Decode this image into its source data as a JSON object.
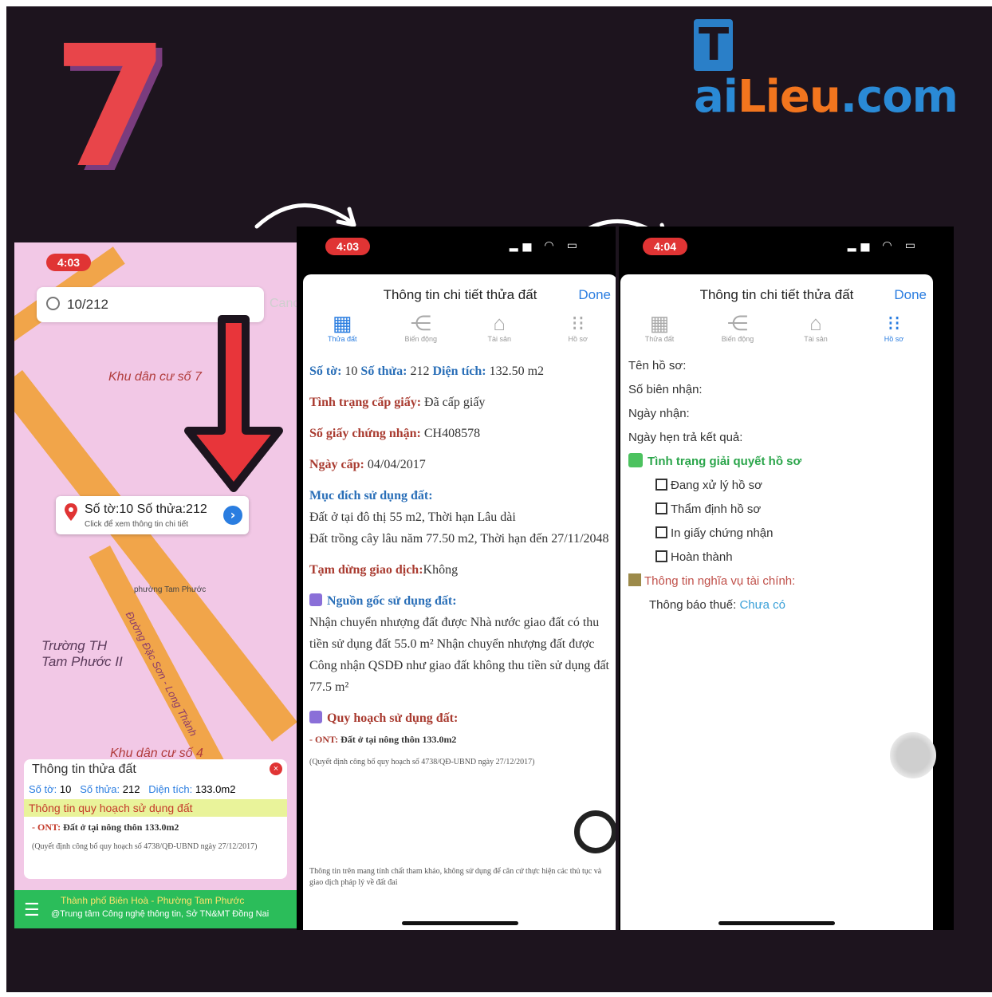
{
  "step_number": "7",
  "logo": {
    "t": "T",
    "ai": "ai",
    "lieu": "Lieu",
    "com": ".com"
  },
  "colors": {
    "accent_red": "#e03434",
    "link_blue": "#2a7de0",
    "green": "#2bbd5a"
  },
  "phone1": {
    "time": "4:03",
    "search_value": "10/212",
    "cancel_label": "Canc",
    "map_labels": [
      "Khu dân cư số 7",
      "Trường TH\nTam Phước II",
      "phường Tam Phước",
      "Khu dân cư số 4",
      "Đường Đặc Sơn - Long Thành"
    ],
    "popup": {
      "title": "Số tờ:10 Số thửa:212",
      "hint": "Click để xem thông tin chi tiết"
    },
    "sheet": {
      "title": "Thông tin thửa đất",
      "so_to_label": "Số tờ:",
      "so_to": "10",
      "so_thua_label": "Số thửa:",
      "so_thua": "212",
      "dien_tich_label": "Diện tích:",
      "dien_tich": "133.0m2",
      "quy_hoach_label": "Thông tin quy hoạch sử dụng đất",
      "ont_code": "- ONT:",
      "ont_text": "Đất ở tại nông thôn 133.0m2",
      "quyet_dinh": "(Quyết định công bố quy hoạch số 4738/QĐ-UBND ngày 27/12/2017)"
    },
    "footer": {
      "line1": "Thành phố Biên Hoà - Phường Tam Phước",
      "line2": "@Trung tâm Công nghệ thông tin, Sở TN&MT Đồng Nai"
    }
  },
  "phone2": {
    "time": "4:03",
    "title": "Thông tin chi tiết thửa đất",
    "done": "Done",
    "tabs": [
      "Thửa đất",
      "Biến động",
      "Tài sản",
      "Hồ sơ"
    ],
    "so_to_label": "Số tờ:",
    "so_to": "10",
    "so_thua_label": "Số thửa:",
    "so_thua": "212",
    "dien_tich_label": "Diện tích:",
    "dien_tich": "132.50 m2",
    "tinh_trang_label": "Tình trạng cấp giấy:",
    "tinh_trang": "Đã cấp giấy",
    "so_giay_label": "Số giấy chứng nhận:",
    "so_giay": "CH408578",
    "ngay_cap_label": "Ngày cấp:",
    "ngay_cap": "04/04/2017",
    "muc_dich_label": "Mục đích sử dụng đất:",
    "muc_dich_1": "Đất ở tại đô thị 55 m2, Thời hạn Lâu dài",
    "muc_dich_2": "Đất trồng cây lâu năm 77.50 m2, Thời hạn đến 27/11/2048",
    "tam_dung_label": "Tạm dừng giao dịch:",
    "tam_dung": "Không",
    "nguon_goc_label": "Nguồn gốc sử dụng đất:",
    "nguon_goc": "Nhận chuyển nhượng đất được Nhà nước giao đất có thu tiền sử dụng đất 55.0 m² Nhận chuyển nhượng đất được Công nhận QSDĐ như giao đất không thu tiền sử dụng đất 77.5 m²",
    "quy_hoach_label": "Quy hoạch sử dụng đất:",
    "ont_code": "- ONT:",
    "ont_text": "Đất ở tại nông thôn 133.0m2",
    "quyet_dinh": "(Quyết định công bố quy hoạch số 4738/QĐ-UBND ngày 27/12/2017)",
    "disclaimer": "Thông tin trên mang tính chất tham khảo, không sử dụng để căn cứ thực hiện các thủ tục và giao dịch pháp lý về đất đai"
  },
  "phone3": {
    "time": "4:04",
    "title": "Thông tin chi tiết thửa đất",
    "done": "Done",
    "tabs": [
      "Thửa đất",
      "Biến động",
      "Tài sản",
      "Hồ sơ"
    ],
    "ten_ho_so": "Tên hồ sơ:",
    "so_bien_nhan": "Số biên nhận:",
    "ngay_nhan": "Ngày nhận:",
    "ngay_hen": "Ngày hẹn trả kết quả:",
    "tinh_trang_label": "Tình trạng giải quyết hồ sơ",
    "steps": [
      "Đang xử lý hồ sơ",
      "Thẩm định hồ sơ",
      "In giấy chứng nhận",
      "Hoàn thành"
    ],
    "nghia_vu_label": "Thông tin nghĩa vụ tài chính:",
    "thong_bao_label": "Thông báo thuế:",
    "thong_bao_value": "Chưa có"
  }
}
